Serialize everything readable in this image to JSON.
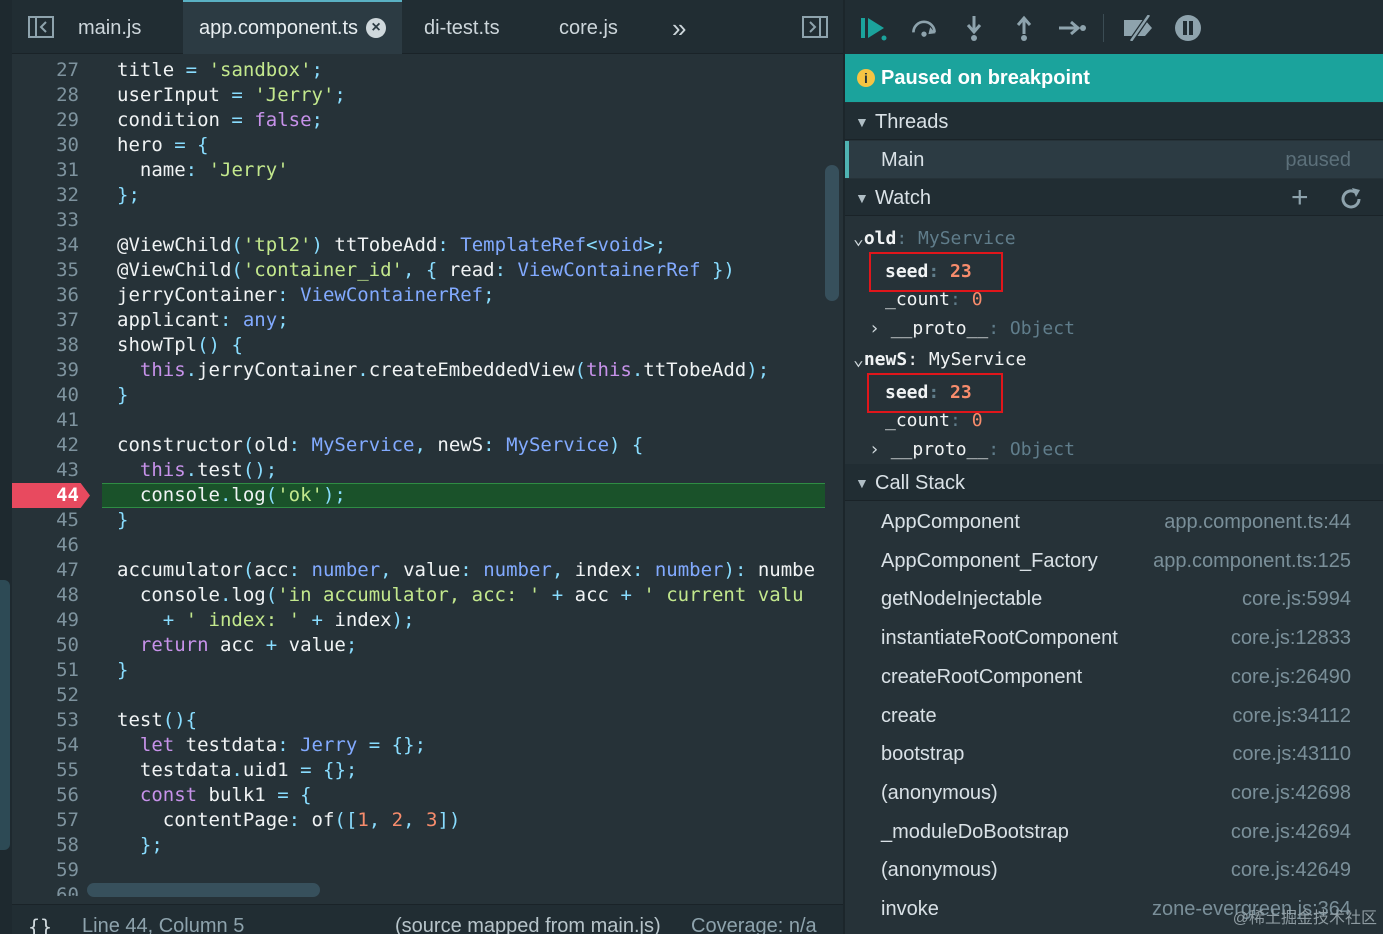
{
  "tabs": [
    {
      "label": "main.js"
    },
    {
      "label": "app.component.ts"
    },
    {
      "label": "di-test.ts"
    },
    {
      "label": "core.js"
    }
  ],
  "tabs_overflow": "»",
  "code_lines": [
    {
      "n": "27"
    },
    {
      "n": "28"
    },
    {
      "n": "29"
    },
    {
      "n": "30"
    },
    {
      "n": "31"
    },
    {
      "n": "32"
    },
    {
      "n": "33"
    },
    {
      "n": "34"
    },
    {
      "n": "35"
    },
    {
      "n": "36"
    },
    {
      "n": "37"
    },
    {
      "n": "38"
    },
    {
      "n": "39"
    },
    {
      "n": "40"
    },
    {
      "n": "41"
    },
    {
      "n": "42"
    },
    {
      "n": "43"
    },
    {
      "n": "44"
    },
    {
      "n": "45"
    },
    {
      "n": "46"
    },
    {
      "n": "47"
    },
    {
      "n": "48"
    },
    {
      "n": "49"
    },
    {
      "n": "50"
    },
    {
      "n": "51"
    },
    {
      "n": "52"
    },
    {
      "n": "53"
    },
    {
      "n": "54"
    },
    {
      "n": "55"
    },
    {
      "n": "56"
    },
    {
      "n": "57"
    },
    {
      "n": "58"
    },
    {
      "n": "59"
    },
    {
      "n": "60"
    }
  ],
  "code_text": [
    "title = 'sandbox';",
    "userInput = 'Jerry';",
    "condition = false;",
    "hero = {",
    "  name: 'Jerry'",
    "};",
    "",
    "@ViewChild('tpl2') ttTobeAdd: TemplateRef<void>;",
    "@ViewChild('container_id', { read: ViewContainerRef })",
    "jerryContainer: ViewContainerRef;",
    "applicant: any;",
    "showTpl() {",
    "  this.jerryContainer.createEmbeddedView(this.ttTobeAdd);",
    "}",
    "",
    "constructor(old: MyService, newS: MyService) {",
    "  this.test();",
    "  console.log('ok');",
    "}",
    "",
    "accumulator(acc: number, value: number, index: number): numbe",
    "  console.log('in accumulator, acc: ' + acc + ' current valu",
    "    + ' index: ' + index);",
    "  return acc + value;",
    "}",
    "",
    "test(){",
    "  let testdata: Jerry = {};",
    "  testdata.uid1 = {};",
    "  const bulk1 = {",
    "    contentPage: of([1, 2, 3])",
    "  };",
    "",
    ""
  ],
  "breakpoint_line": "44",
  "status": {
    "braces": "{}",
    "position": "Line 44, Column 5",
    "source_mapped": "(source mapped from main.js)",
    "coverage": "Coverage: n/a"
  },
  "debugger": {
    "paused_text": "Paused on breakpoint",
    "threads_header": "Threads",
    "thread_name": "Main",
    "thread_state": "paused",
    "watch_header": "Watch",
    "watch": {
      "old_name": "old",
      "old_type": "MyService",
      "news_name": "newS",
      "news_type": "MyService",
      "seed_key": "seed",
      "seed_val": "23",
      "count_key": "_count",
      "count_val": "0",
      "proto_key": "__proto__",
      "proto_val": "Object"
    },
    "callstack_header": "Call Stack",
    "call_stack": [
      {
        "fn": "AppComponent",
        "loc": "app.component.ts:44"
      },
      {
        "fn": "AppComponent_Factory",
        "loc": "app.component.ts:125"
      },
      {
        "fn": "getNodeInjectable",
        "loc": "core.js:5994"
      },
      {
        "fn": "instantiateRootComponent",
        "loc": "core.js:12833"
      },
      {
        "fn": "createRootComponent",
        "loc": "core.js:26490"
      },
      {
        "fn": "create",
        "loc": "core.js:34112"
      },
      {
        "fn": "bootstrap",
        "loc": "core.js:43110"
      },
      {
        "fn": "(anonymous)",
        "loc": "core.js:42698"
      },
      {
        "fn": "_moduleDoBootstrap",
        "loc": "core.js:42694"
      },
      {
        "fn": "(anonymous)",
        "loc": "core.js:42649"
      },
      {
        "fn": "invoke",
        "loc": "zone-evergreen.js:364"
      }
    ],
    "watermark": "@稀土掘金技术社区"
  },
  "colors": {
    "banner": "#1ba39c",
    "breakpoint": "#e84a5f",
    "highlight_line": "#1a522a",
    "annotation_box": "#e0161b"
  }
}
